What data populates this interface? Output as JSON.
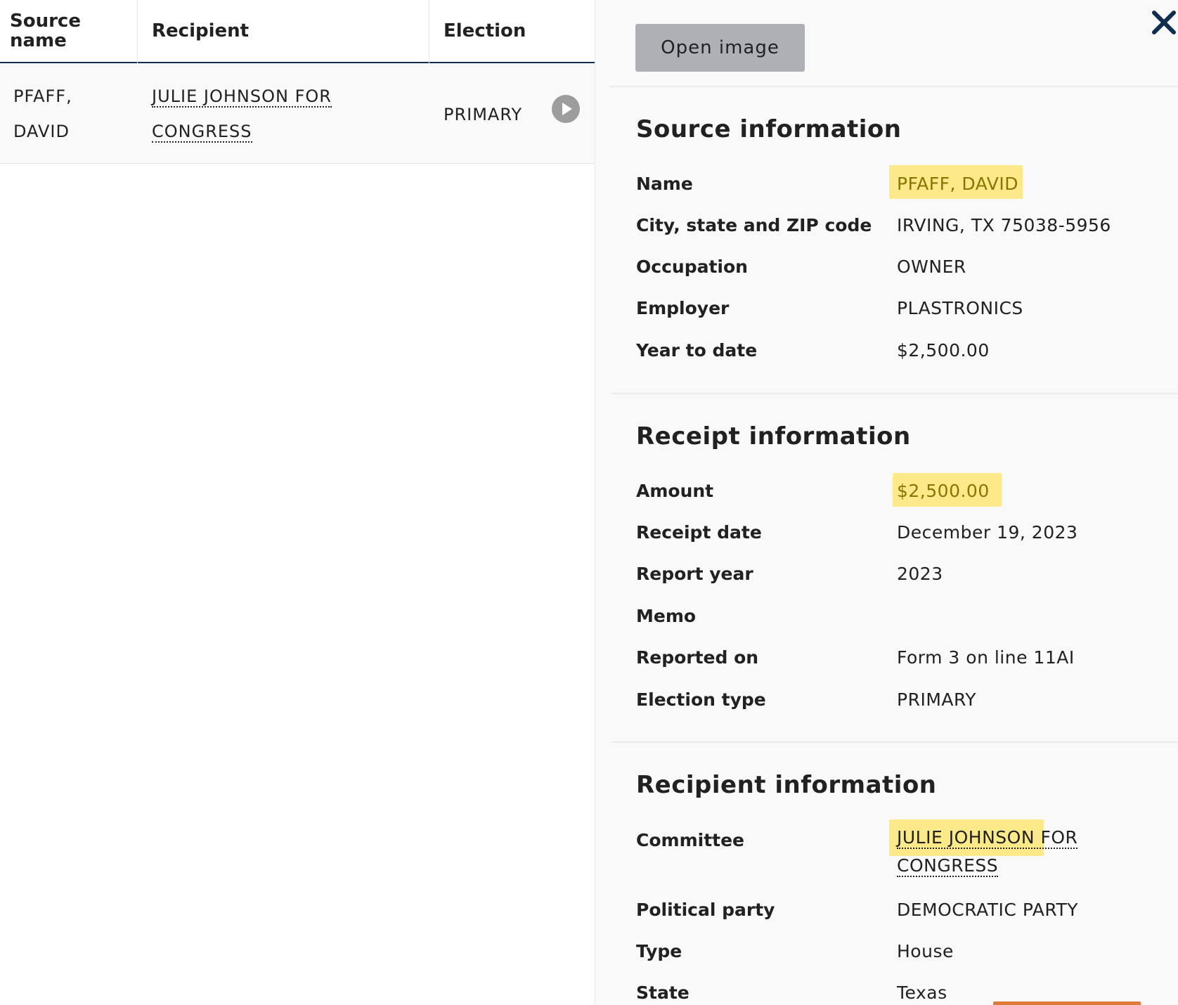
{
  "table": {
    "headers": {
      "source_line1": "Source",
      "source_line2": "name",
      "recipient": "Recipient",
      "election": "Election"
    },
    "row": {
      "source_line1": "PFAFF,",
      "source_line2": "DAVID",
      "recipient_line1": "JULIE JOHNSON FOR",
      "recipient_line2": "CONGRESS",
      "election": "PRIMARY"
    }
  },
  "panel": {
    "open_image_label": "Open image",
    "source_info": {
      "title": "Source information",
      "rows": [
        {
          "label": "Name",
          "value": "PFAFF, DAVID"
        },
        {
          "label": "City, state and ZIP code",
          "value": "IRVING, TX 75038-5956"
        },
        {
          "label": "Occupation",
          "value": "OWNER"
        },
        {
          "label": "Employer",
          "value": "PLASTRONICS"
        },
        {
          "label": "Year to date",
          "value": "$2,500.00"
        }
      ]
    },
    "receipt_info": {
      "title": "Receipt information",
      "rows": [
        {
          "label": "Amount",
          "value": "$2,500.00"
        },
        {
          "label": "Receipt date",
          "value": "December 19, 2023"
        },
        {
          "label": "Report year",
          "value": "2023"
        },
        {
          "label": "Memo",
          "value": ""
        },
        {
          "label": "Reported on",
          "value": "Form 3 on line 11AI"
        },
        {
          "label": "Election type",
          "value": "PRIMARY"
        }
      ]
    },
    "recipient_info": {
      "title": "Recipient information",
      "rows": [
        {
          "label": "Committee",
          "value_line1": "JULIE JOHNSON FOR",
          "value_line2": "CONGRESS"
        },
        {
          "label": "Political party",
          "value": "DEMOCRATIC PARTY"
        },
        {
          "label": "Type",
          "value": "House"
        },
        {
          "label": "State",
          "value": "Texas"
        }
      ]
    }
  },
  "colors": {
    "highlight": "#fbe98a",
    "header_rule": "#112e51",
    "button_gray": "#aeb0b5",
    "close_icon": "#112e51",
    "accent_orange": "#e07b39"
  },
  "icons": {
    "close": "close-icon",
    "expand": "play-circle-icon"
  }
}
